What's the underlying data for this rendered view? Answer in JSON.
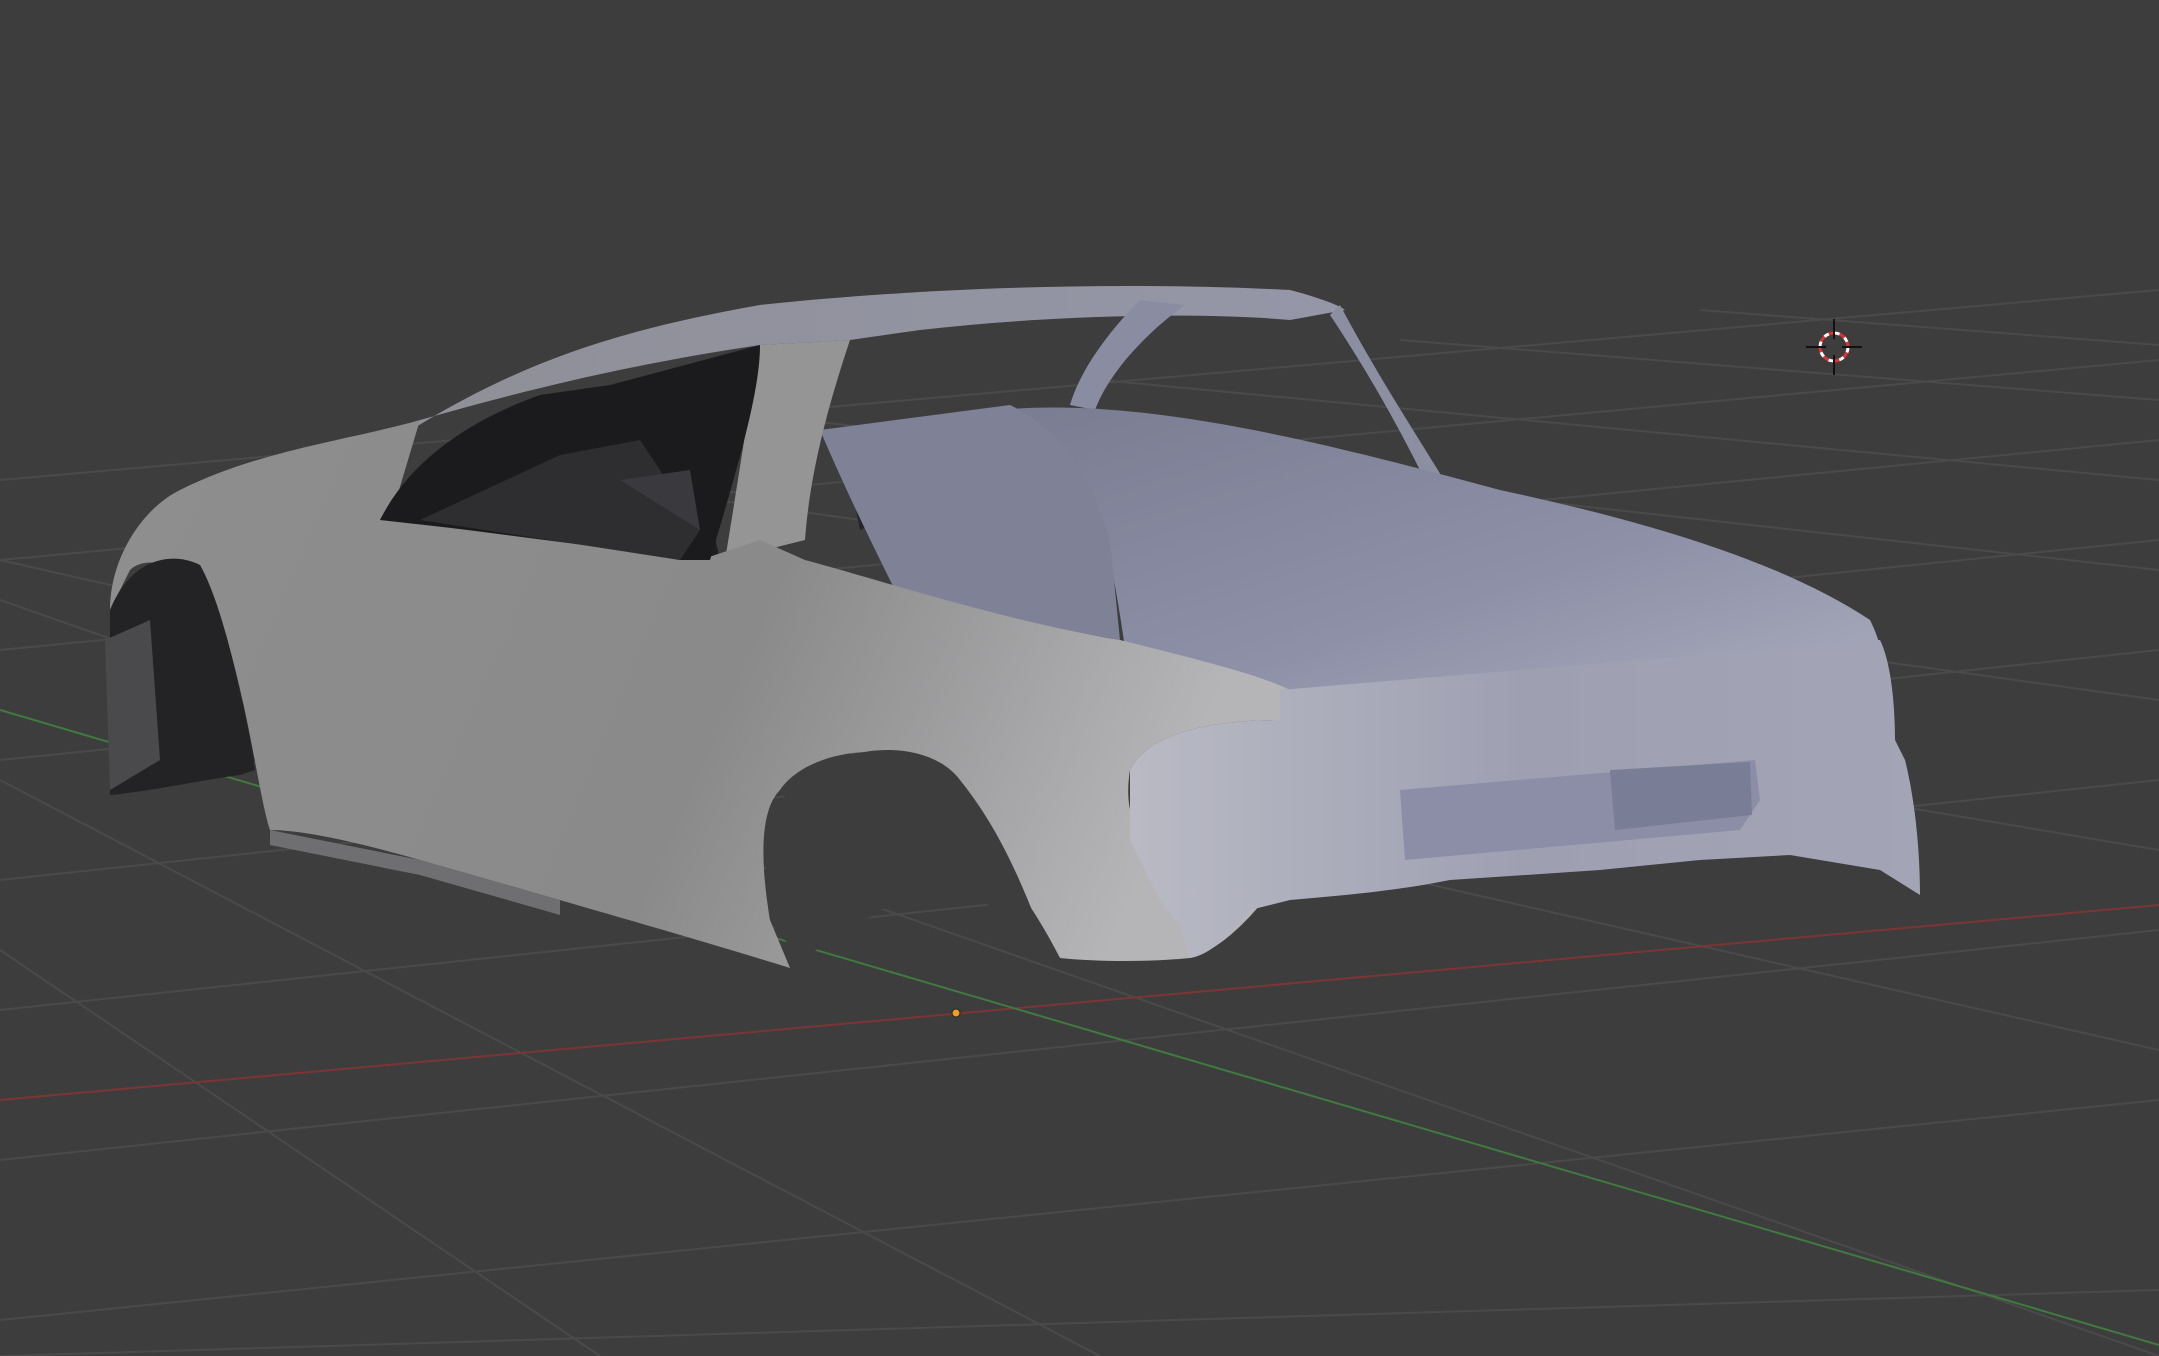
{
  "viewport": {
    "background": "#3d3d3d",
    "grid_color": "#474747",
    "axis_x_color": "#8b3a3a",
    "axis_y_color": "#3f7f3f",
    "origin_color": "#f0a020"
  },
  "model": {
    "side_color": "#9a9a9a",
    "top_color": "#8e90a6",
    "shadow_color": "#1f1f22"
  },
  "icons": {
    "cursor": "3d-cursor-icon",
    "origin": "object-origin-dot"
  }
}
